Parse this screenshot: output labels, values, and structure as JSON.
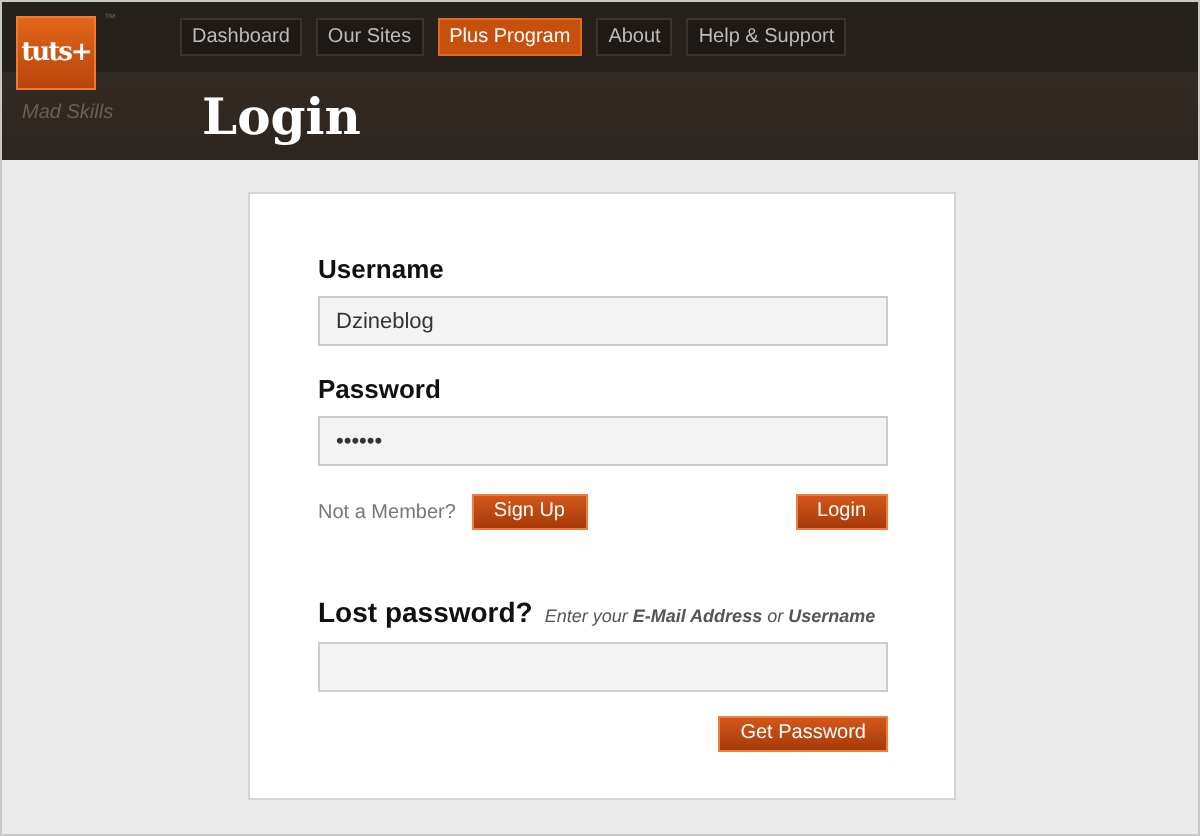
{
  "logo": {
    "text": "tuts+",
    "trademark": "™",
    "tagline": "Mad Skills"
  },
  "nav": [
    {
      "label": "Dashboard",
      "selected": false
    },
    {
      "label": "Our Sites",
      "selected": false
    },
    {
      "label": "Plus Program",
      "selected": true
    },
    {
      "label": "About",
      "selected": false
    },
    {
      "label": "Help & Support",
      "selected": false
    }
  ],
  "page_title": "Login",
  "form": {
    "username_label": "Username",
    "username_value": "Dzineblog",
    "password_label": "Password",
    "password_value": "••••••",
    "member_prompt": "Not a Member?",
    "signup_button": "Sign Up",
    "login_button": "Login"
  },
  "lost": {
    "heading": "Lost password?",
    "hint": "Enter your **E-Mail Address** or **Username**",
    "button": "Get Password"
  }
}
